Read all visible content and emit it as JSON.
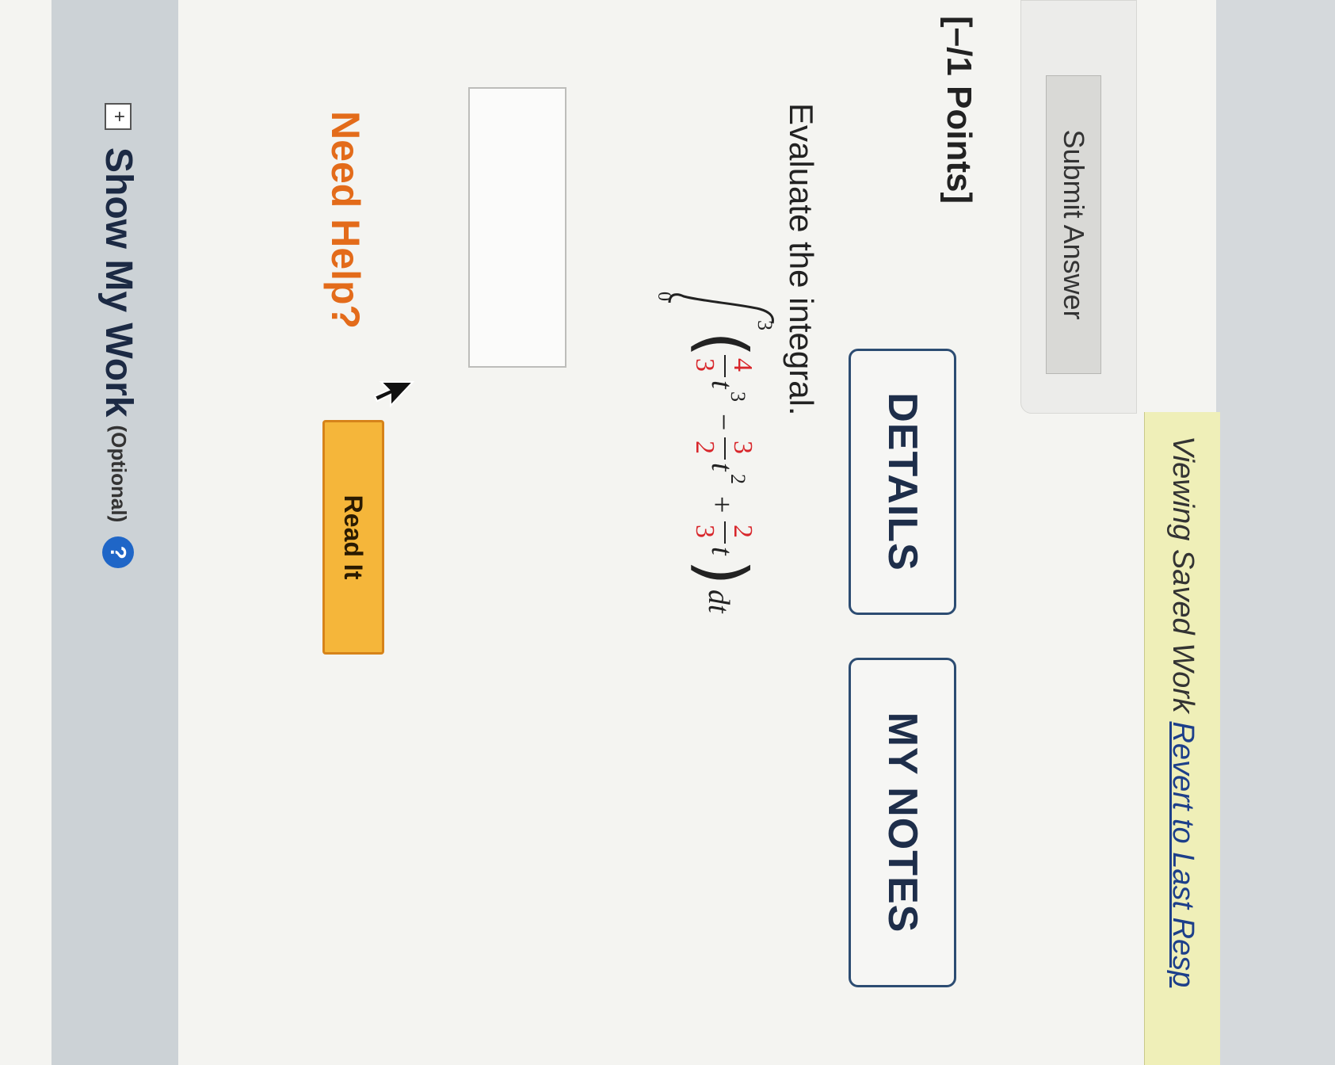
{
  "banner": {
    "text": "Viewing Saved Work ",
    "link": "Revert to Last Resp"
  },
  "toolbar": {
    "submit_label": "Submit Answer"
  },
  "question": {
    "points": "[–/1 Points]",
    "tabs": [
      "DETAILS",
      "MY NOTES"
    ],
    "prompt": "Evaluate the integral.",
    "integral": {
      "lower": "0",
      "upper": "3",
      "terms": [
        {
          "sign": "",
          "num": "4",
          "den": "3",
          "var": "t",
          "exp": "3"
        },
        {
          "sign": "−",
          "num": "3",
          "den": "2",
          "var": "t",
          "exp": "2"
        },
        {
          "sign": "+",
          "num": "2",
          "den": "3",
          "var": "t",
          "exp": ""
        }
      ],
      "differential": "dt"
    },
    "answer_value": ""
  },
  "help": {
    "label": "Need Help?",
    "read_it": "Read It"
  },
  "show_work": {
    "label": "Show My Work",
    "optional": "(Optional)",
    "help_icon": "?"
  },
  "colors": {
    "accent_orange": "#e36b1a",
    "tab_border": "#2c4c72",
    "fraction_red": "#d8262b",
    "help_blue": "#1f66c7"
  }
}
